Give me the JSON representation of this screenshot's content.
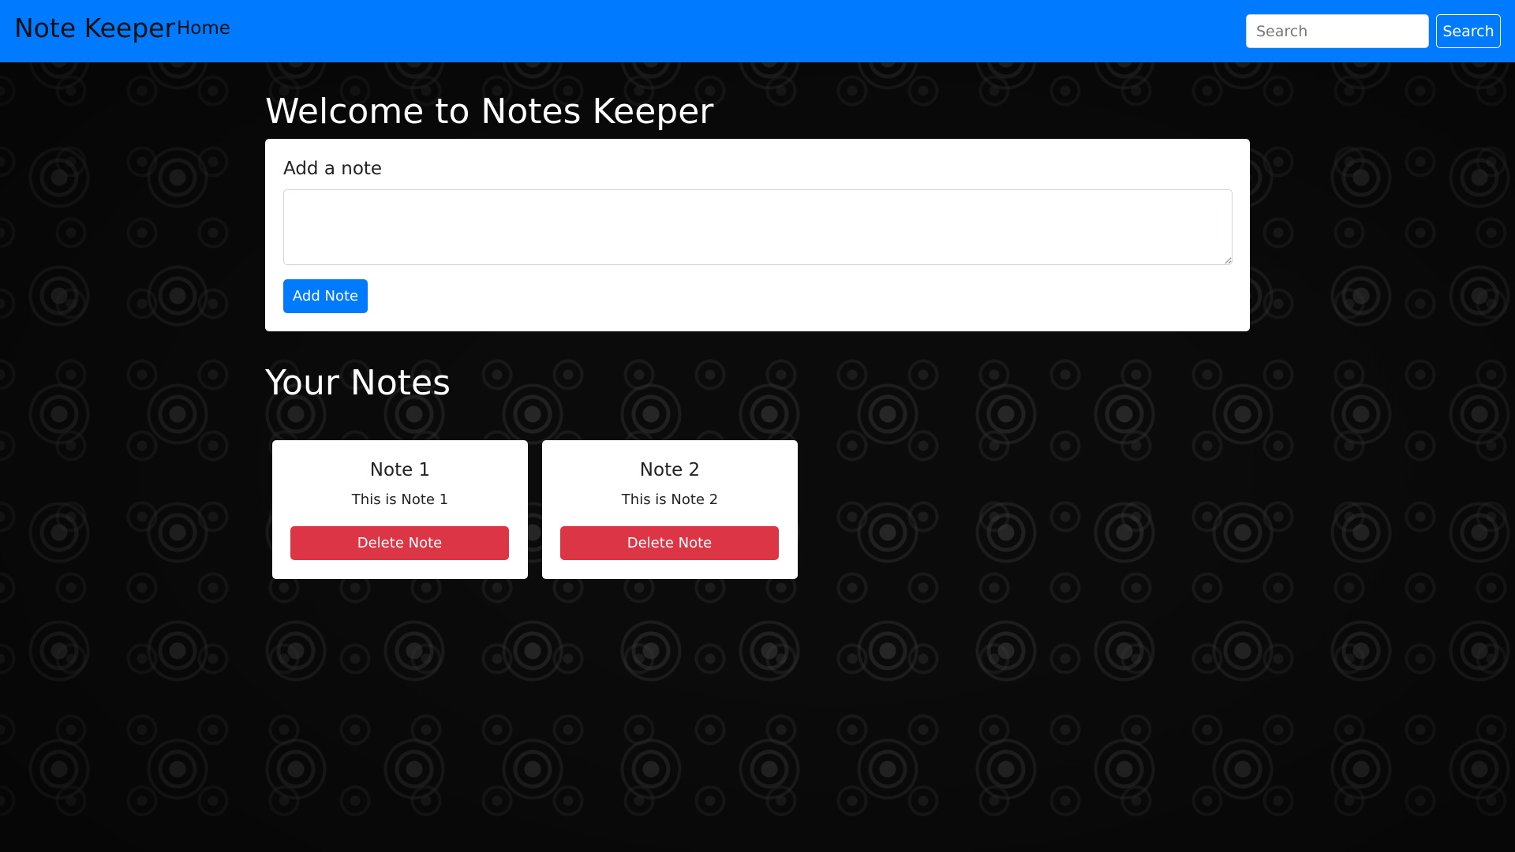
{
  "navbar": {
    "brand": "Note Keeper",
    "home_label": "Home",
    "search_placeholder": "Search",
    "search_value": "",
    "search_button": "Search",
    "color": "#007bff"
  },
  "main": {
    "welcome_heading": "Welcome to Notes Keeper",
    "add_card": {
      "title": "Add a note",
      "textarea_value": "",
      "add_button": "Add Note"
    },
    "notes_heading": "Your Notes",
    "notes": [
      {
        "title": "Note 1",
        "text": "This is Note 1",
        "delete_label": "Delete Note"
      },
      {
        "title": "Note 2",
        "text": "This is Note 2",
        "delete_label": "Delete Note"
      }
    ]
  },
  "colors": {
    "primary": "#007bff",
    "danger": "#dc3545",
    "background": "#0b0b0b"
  }
}
